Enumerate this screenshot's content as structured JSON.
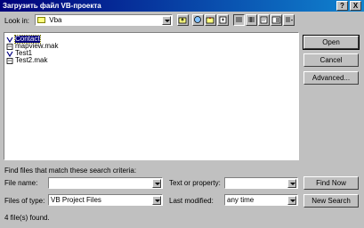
{
  "window": {
    "title": "Загрузить файл VB-проекта",
    "help_btn": "?",
    "close_btn": "X"
  },
  "lookin": {
    "label": "Look in:",
    "value": "Vba"
  },
  "files": [
    {
      "name": "Contact",
      "selected": true,
      "icon": "vb-file-icon"
    },
    {
      "name": "mapview.mak",
      "selected": false,
      "icon": "mak-file-icon"
    },
    {
      "name": "Test1",
      "selected": false,
      "icon": "vb-file-icon"
    },
    {
      "name": "Test2.mak",
      "selected": false,
      "icon": "mak-file-icon"
    }
  ],
  "buttons": {
    "open": "Open",
    "cancel": "Cancel",
    "advanced": "Advanced...",
    "find_now": "Find Now",
    "new_search": "New Search"
  },
  "search": {
    "heading": "Find files that match these search criteria:",
    "filename_label": "File name:",
    "filename_value": "",
    "text_label": "Text or property:",
    "text_value": "",
    "filetype_label": "Files of type:",
    "filetype_value": "VB Project Files",
    "lastmod_label": "Last modified:",
    "lastmod_value": "any time"
  },
  "status": "4 file(s) found."
}
